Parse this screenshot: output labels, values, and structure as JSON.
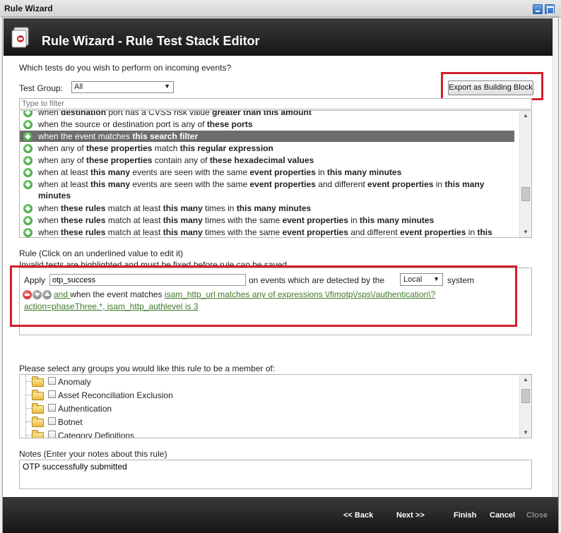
{
  "window": {
    "title": "Rule Wizard",
    "header_title": "Rule Wizard - Rule Test Stack Editor"
  },
  "tests": {
    "question": "Which tests do you wish to perform on incoming events?",
    "group_label": "Test Group:",
    "group_value": "All",
    "export_label": "Export as Building Block",
    "filter_placeholder": "Type to filter",
    "items": [
      {
        "segments": [
          {
            "t": "when ",
            "b": false
          },
          {
            "t": "destination",
            "b": true
          },
          {
            "t": " port has a CVSS risk value ",
            "b": false
          },
          {
            "t": "greater than this amount",
            "b": true
          }
        ],
        "selected": false
      },
      {
        "segments": [
          {
            "t": "when the source or destination port is any of ",
            "b": false
          },
          {
            "t": "these ports",
            "b": true
          }
        ],
        "selected": false
      },
      {
        "segments": [
          {
            "t": "when the event matches ",
            "b": false
          },
          {
            "t": "this search filter",
            "b": true
          }
        ],
        "selected": true
      },
      {
        "segments": [
          {
            "t": "when any of ",
            "b": false
          },
          {
            "t": "these properties",
            "b": true
          },
          {
            "t": " match ",
            "b": false
          },
          {
            "t": "this regular expression",
            "b": true
          }
        ],
        "selected": false
      },
      {
        "segments": [
          {
            "t": "when any of ",
            "b": false
          },
          {
            "t": "these properties",
            "b": true
          },
          {
            "t": " contain any of ",
            "b": false
          },
          {
            "t": "these hexadecimal values",
            "b": true
          }
        ],
        "selected": false
      },
      {
        "segments": [
          {
            "t": "when at least ",
            "b": false
          },
          {
            "t": "this many",
            "b": true
          },
          {
            "t": " events are seen with the same ",
            "b": false
          },
          {
            "t": "event properties",
            "b": true
          },
          {
            "t": " in ",
            "b": false
          },
          {
            "t": "this many minutes",
            "b": true
          }
        ],
        "selected": false
      },
      {
        "segments": [
          {
            "t": "when at least ",
            "b": false
          },
          {
            "t": "this many",
            "b": true
          },
          {
            "t": " events are seen with the same ",
            "b": false
          },
          {
            "t": "event properties",
            "b": true
          },
          {
            "t": " and different ",
            "b": false
          },
          {
            "t": "event properties",
            "b": true
          },
          {
            "t": " in ",
            "b": false
          },
          {
            "t": "this many minutes",
            "b": true
          }
        ],
        "selected": false
      },
      {
        "segments": [
          {
            "t": "when ",
            "b": false
          },
          {
            "t": "these rules",
            "b": true
          },
          {
            "t": " match at least ",
            "b": false
          },
          {
            "t": "this many",
            "b": true
          },
          {
            "t": " times in ",
            "b": false
          },
          {
            "t": "this many minutes",
            "b": true
          }
        ],
        "selected": false
      },
      {
        "segments": [
          {
            "t": "when ",
            "b": false
          },
          {
            "t": "these rules",
            "b": true
          },
          {
            "t": " match at least ",
            "b": false
          },
          {
            "t": "this many",
            "b": true
          },
          {
            "t": " times with the same ",
            "b": false
          },
          {
            "t": "event properties",
            "b": true
          },
          {
            "t": " in ",
            "b": false
          },
          {
            "t": "this many minutes",
            "b": true
          }
        ],
        "selected": false
      },
      {
        "segments": [
          {
            "t": "when ",
            "b": false
          },
          {
            "t": "these rules",
            "b": true
          },
          {
            "t": " match at least ",
            "b": false
          },
          {
            "t": "this many",
            "b": true
          },
          {
            "t": " times with the same ",
            "b": false
          },
          {
            "t": "event properties",
            "b": true
          },
          {
            "t": " and different ",
            "b": false
          },
          {
            "t": "event properties",
            "b": true
          },
          {
            "t": " in ",
            "b": false
          },
          {
            "t": "this",
            "b": true
          }
        ],
        "selected": false
      }
    ]
  },
  "rule": {
    "title": "Rule (Click on an underlined value to edit it)",
    "subtitle": "Invalid tests are highlighted and must be fixed before rule can be saved.",
    "apply_label": "Apply",
    "name_value": "otp_success",
    "on_events_label": "on events which are detected by the",
    "system_value": "Local",
    "system_label": "system",
    "and_link": " and ",
    "condition_prefix": "when the event matches ",
    "condition_link_1": "isam_http_url matches any of expressions \\/fimotp\\/sps\\/authentication\\?",
    "condition_link_2": "action=phaseThree.*, isam_http_authlevel is 3"
  },
  "groups": {
    "label": "Please select any groups you would like this rule to be a member of:",
    "items": [
      "Anomaly",
      "Asset Reconciliation Exclusion",
      "Authentication",
      "Botnet",
      "Category Definitions"
    ]
  },
  "notes": {
    "label": "Notes (Enter your notes about this rule)",
    "value": "OTP successfully submitted"
  },
  "footer": {
    "back": "<< Back",
    "next": "Next >>",
    "finish": "Finish",
    "cancel": "Cancel",
    "close": "Close"
  }
}
